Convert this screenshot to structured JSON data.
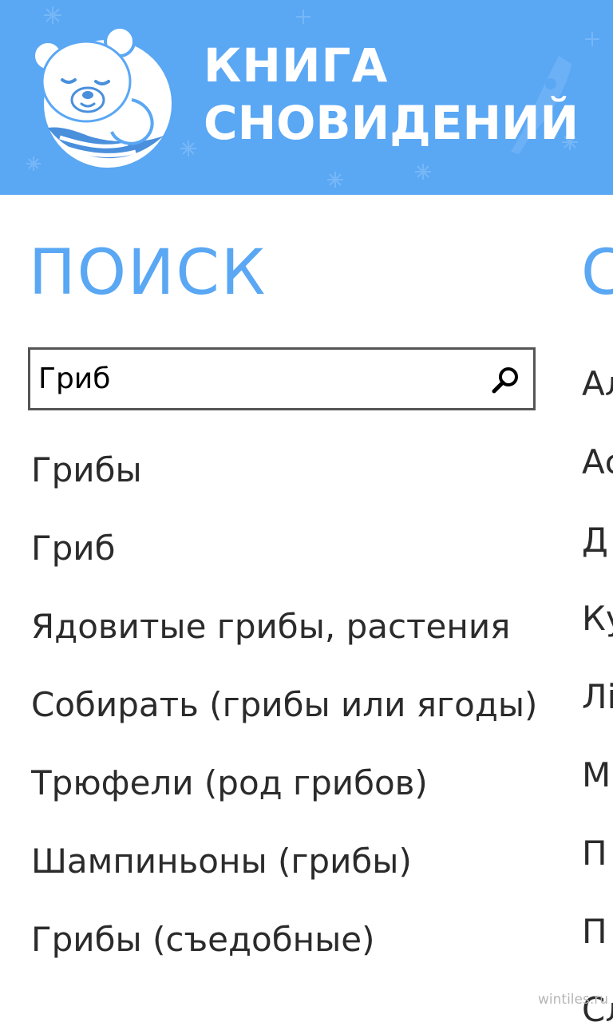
{
  "app": {
    "title_line1": "КНИГА",
    "title_line2": "СНОВИДЕНИЙ",
    "accent_color": "#5aa7f4",
    "logo_icon": "sleeping-bear-logo-icon"
  },
  "pivot": {
    "current_header": "ПОИСК",
    "next_header_peek": "С"
  },
  "search": {
    "value": "Гриб",
    "placeholder": "",
    "button_icon": "search-icon"
  },
  "results": [
    "Грибы",
    "Гриб",
    "Ядовитые грибы, растения",
    "Собирать (грибы или ягоды)",
    "Трюфели (род грибов)",
    "Шампиньоны (грибы)",
    "Грибы (съедобные)"
  ],
  "next_panel_items": [
    "Ал",
    "Ас",
    "Д",
    "Ку",
    "Лі",
    "М",
    "П",
    "П",
    "Сл"
  ],
  "watermark": "wintiles.ru"
}
